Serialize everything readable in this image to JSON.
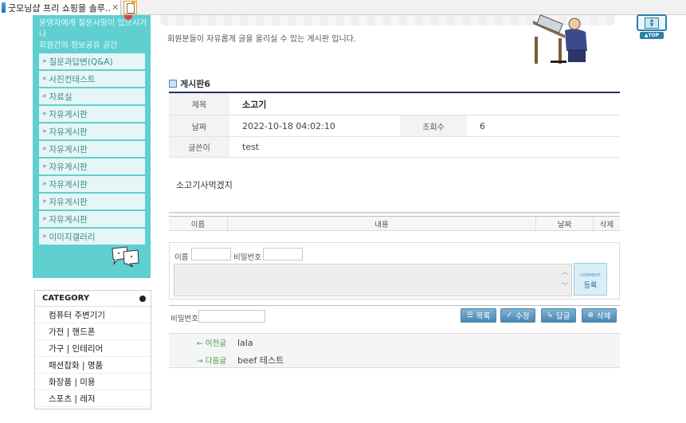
{
  "browser": {
    "tab_title": "굿모닝샵 프리 쇼핑몰 솔루..."
  },
  "sidebar": {
    "intro": "운영자에게 질문사항이 있으시거나\n회원간의 정보공유 공간",
    "items": [
      {
        "label": "질문과답변(Q&A)"
      },
      {
        "label": "사진컨테스트"
      },
      {
        "label": "자료실"
      },
      {
        "label": "자유게시판"
      },
      {
        "label": "자유게시판"
      },
      {
        "label": "자유게시판"
      },
      {
        "label": "자유게시판"
      },
      {
        "label": "자유게시판"
      },
      {
        "label": "자유게시판"
      },
      {
        "label": "자유게시판"
      },
      {
        "label": "이미지갤러리"
      }
    ]
  },
  "category": {
    "title": "CATEGORY",
    "items": [
      {
        "label": "컴퓨터 주변기기"
      },
      {
        "label": "가전 | 핸드폰"
      },
      {
        "label": "가구 | 인테리어"
      },
      {
        "label": "패션잡화 | 명품"
      },
      {
        "label": "화장품 | 미용"
      },
      {
        "label": "스포츠 | 레저"
      }
    ]
  },
  "board": {
    "description": "회원분들이 자유롭게 글을 올리실 수 있는 게시판 입니다.",
    "title": "게시판6"
  },
  "post": {
    "subject_label": "제목",
    "subject": "소고기",
    "date_label": "날짜",
    "date": "2022-10-18 04:02:10",
    "views_label": "조회수",
    "views": "6",
    "author_label": "글쓴이",
    "author": "test",
    "content": "소고기사먹겠지"
  },
  "comments": {
    "col_name": "이름",
    "col_content": "내용",
    "col_date": "날짜",
    "col_delete": "삭제",
    "name_label": "이름",
    "password_label": "비밀번호",
    "submit_en": "COMMENT",
    "submit_ko": "등록"
  },
  "actions": {
    "password_label": "비밀번호",
    "list": "목록",
    "edit": "수정",
    "reply": "답글",
    "delete": "삭제"
  },
  "navigation": {
    "prev_label": "← 이전글",
    "prev_title": "lala",
    "next_label": "→ 다음글",
    "next_title": "beef 테스트"
  },
  "top_button": {
    "label": "▲TOP"
  },
  "colors": {
    "sidebar_bg": "#5fcfd0",
    "table_header_line": "#2b2f6e",
    "button_blue": "#4a87b0",
    "nav_green": "#3d9a3d"
  }
}
